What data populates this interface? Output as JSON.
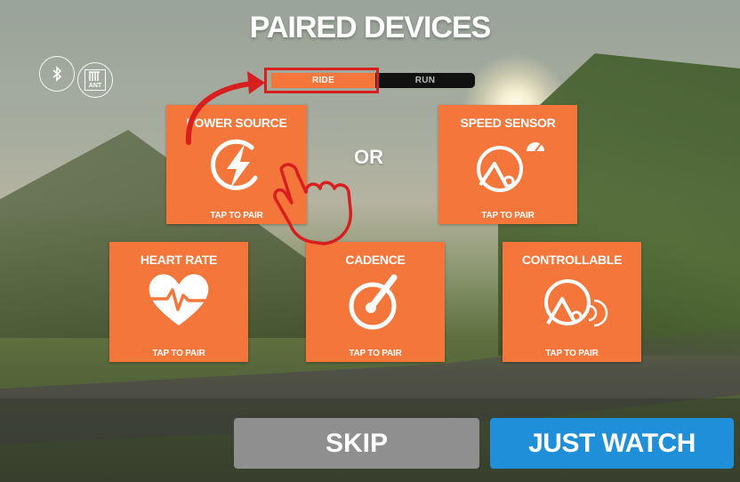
{
  "page": {
    "title": "PAIRED DEVICES"
  },
  "connectivity": {
    "bluetooth_icon": "bluetooth-icon",
    "ant_icon": "ant-icon",
    "ant_label": "ANT"
  },
  "tabs": [
    {
      "label": "RIDE",
      "selected": true
    },
    {
      "label": "RUN",
      "selected": false
    }
  ],
  "divider_text": "OR",
  "devices": [
    {
      "label": "POWER SOURCE",
      "action": "TAP TO PAIR",
      "icon": "lightning-icon"
    },
    {
      "label": "SPEED SENSOR",
      "action": "TAP TO PAIR",
      "icon": "speed-sensor-icon"
    },
    {
      "label": "HEART RATE",
      "action": "TAP TO PAIR",
      "icon": "heart-rate-icon"
    },
    {
      "label": "CADENCE",
      "action": "TAP TO PAIR",
      "icon": "cadence-icon"
    },
    {
      "label": "CONTROLLABLE",
      "action": "TAP TO PAIR",
      "icon": "controllable-trainer-icon"
    }
  ],
  "buttons": {
    "skip": "SKIP",
    "just_watch": "JUST WATCH"
  },
  "colors": {
    "accent_orange": "#f4763a",
    "button_blue": "#1e8fd8",
    "button_gray": "#8f8f8f",
    "annotation_red": "#d81e1e"
  }
}
